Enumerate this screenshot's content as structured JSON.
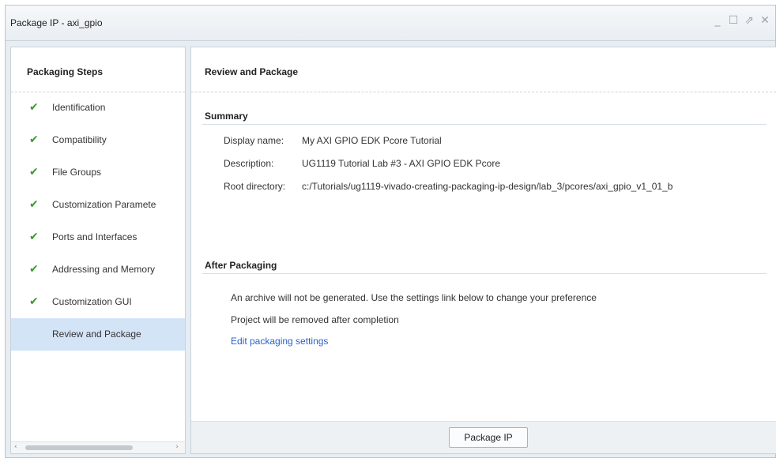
{
  "window": {
    "title": "Package IP - axi_gpio",
    "controls": {
      "minimize": "_",
      "maximize": "☐",
      "restore": "⇗",
      "close": "✕"
    }
  },
  "left": {
    "header": "Packaging Steps",
    "check_glyph": "✔",
    "steps": [
      {
        "label": "Identification",
        "done": true
      },
      {
        "label": "Compatibility",
        "done": true
      },
      {
        "label": "File Groups",
        "done": true
      },
      {
        "label": "Customization Paramete",
        "done": true
      },
      {
        "label": "Ports and Interfaces",
        "done": true
      },
      {
        "label": "Addressing and Memory",
        "done": true
      },
      {
        "label": "Customization GUI",
        "done": true
      },
      {
        "label": "Review and Package",
        "done": false,
        "selected": true
      }
    ],
    "scroll": {
      "left": "‹",
      "right": "›"
    }
  },
  "right": {
    "header": "Review and Package",
    "summary": {
      "title": "Summary",
      "display_name_label": "Display name:",
      "display_name_value": "My AXI GPIO EDK Pcore Tutorial",
      "description_label": "Description:",
      "description_value": "UG1119 Tutorial Lab #3 - AXI GPIO EDK Pcore",
      "root_label": "Root directory:",
      "root_value": "c:/Tutorials/ug1119-vivado-creating-packaging-ip-design/lab_3/pcores/axi_gpio_v1_01_b"
    },
    "after": {
      "title": "After Packaging",
      "line1": "An archive will not be generated. Use the settings link below to change your preference",
      "line2": "Project will be removed after completion",
      "link": "Edit packaging settings"
    },
    "package_button": "Package IP"
  },
  "colors": {
    "check": "#3a9a2e",
    "selected_bg": "#d4e4f7",
    "link": "#2a62c9"
  }
}
